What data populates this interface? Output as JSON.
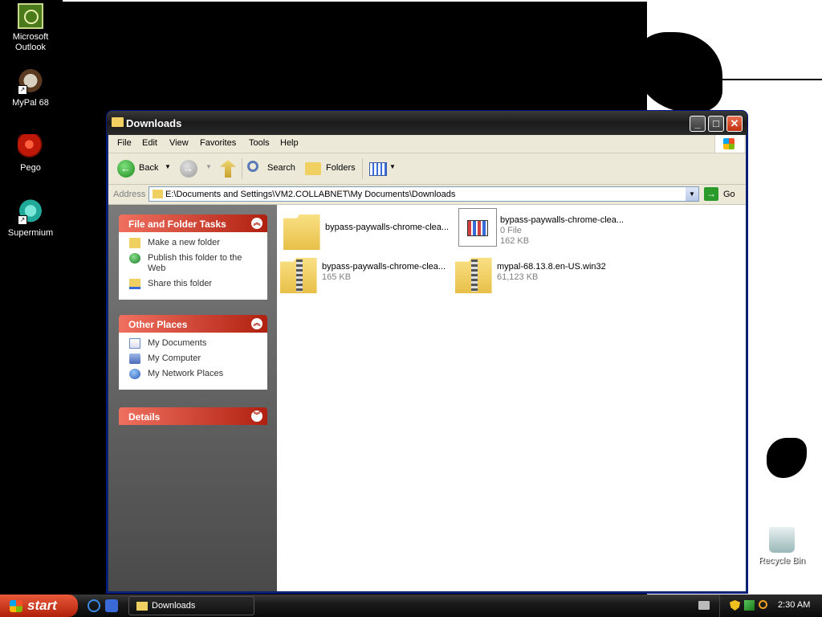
{
  "desktop": {
    "icons": [
      {
        "label_line1": "Microsoft",
        "label_line2": "Outlook"
      },
      {
        "label_line1": "MyPal 68",
        "label_line2": ""
      },
      {
        "label_line1": "Pego",
        "label_line2": ""
      },
      {
        "label_line1": "Supermium",
        "label_line2": ""
      }
    ],
    "recycle_bin": "Recycle Bin"
  },
  "window": {
    "title": "Downloads",
    "menu": [
      "File",
      "Edit",
      "View",
      "Favorites",
      "Tools",
      "Help"
    ],
    "toolbar": {
      "back": "Back",
      "search": "Search",
      "folders": "Folders"
    },
    "address": {
      "label": "Address",
      "path": "E:\\Documents and Settings\\VM2.COLLABNET\\My Documents\\Downloads",
      "go": "Go"
    },
    "sidepanel": {
      "file_tasks": {
        "title": "File and Folder Tasks",
        "items": [
          "Make a new folder",
          "Publish this folder to the Web",
          "Share this folder"
        ]
      },
      "other_places": {
        "title": "Other Places",
        "items": [
          "My Documents",
          "My Computer",
          "My Network Places"
        ]
      },
      "details": {
        "title": "Details"
      }
    },
    "files": [
      {
        "name": "bypass-paywalls-chrome-clea...",
        "type": "folder",
        "line2": "",
        "line3": ""
      },
      {
        "name": "bypass-paywalls-chrome-clea...",
        "type": "file",
        "line2": "0 File",
        "line3": "162 KB"
      },
      {
        "name": "bypass-paywalls-chrome-clea...",
        "type": "zip",
        "line2": "165 KB",
        "line3": ""
      },
      {
        "name": "mypal-68.13.8.en-US.win32",
        "type": "zip",
        "line2": "61,123 KB",
        "line3": ""
      }
    ]
  },
  "taskbar": {
    "start": "start",
    "task_button": "Downloads",
    "clock": "2:30 AM"
  }
}
